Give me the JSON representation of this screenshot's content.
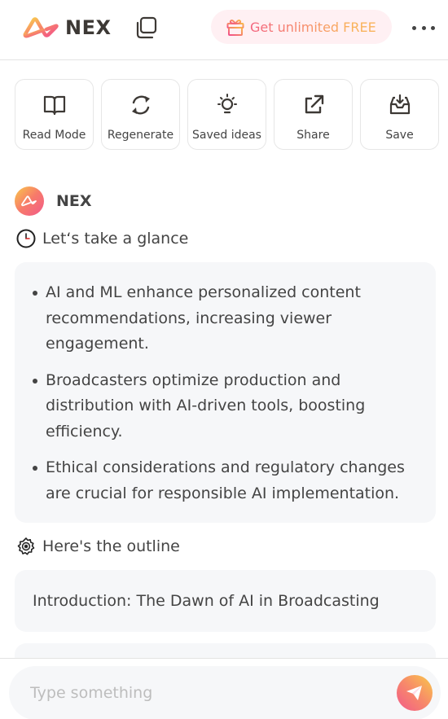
{
  "header": {
    "logo_text": "NEX",
    "promo_label": "Get unlimited FREE"
  },
  "actions": [
    {
      "label": "Read Mode",
      "icon": "book-icon"
    },
    {
      "label": "Regenerate",
      "icon": "refresh-icon"
    },
    {
      "label": "Saved ideas",
      "icon": "lightbulb-icon"
    },
    {
      "label": "Share",
      "icon": "external-link-icon"
    },
    {
      "label": "Save",
      "icon": "inbox-download-icon"
    }
  ],
  "bot": {
    "name": "NEX"
  },
  "glance": {
    "title": "Let‘s take a glance",
    "bullets": [
      "AI and ML enhance personalized content recommendations, increasing viewer engagement.",
      "Broadcasters optimize production and distribution with AI-driven tools, boosting efficiency.",
      "Ethical considerations and regulatory changes are crucial for responsible AI implementation."
    ]
  },
  "outline": {
    "title": "Here's the outline",
    "items": [
      "Introduction: The Dawn of AI in Broadcasting"
    ]
  },
  "composer": {
    "placeholder": "Type something"
  },
  "colors": {
    "brand_gradient_start": "#f9c84a",
    "brand_gradient_end": "#f25a8a",
    "promo_bg": "#fff0f3",
    "card_bg": "#f6f7f9"
  }
}
